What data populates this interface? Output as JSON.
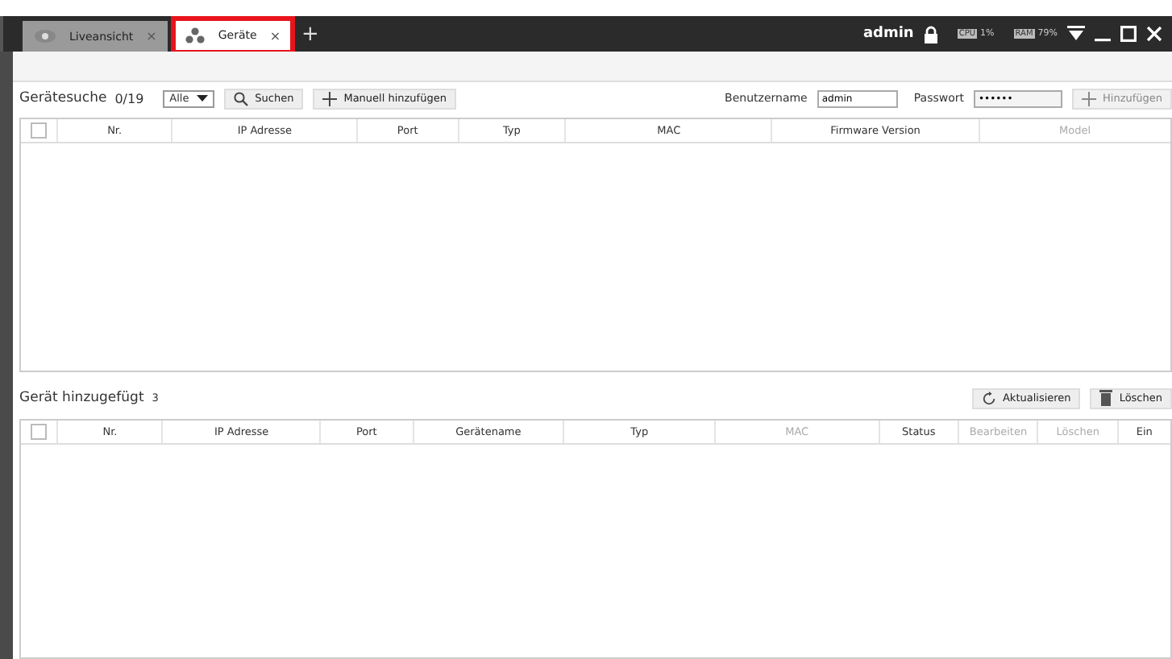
{
  "tabs": [
    {
      "label": "Liveansicht",
      "kind": "live",
      "selected": false,
      "highlighted": false,
      "close": "×"
    },
    {
      "label": "Geräte",
      "kind": "devices",
      "selected": true,
      "highlighted": true,
      "close": "×"
    }
  ],
  "new_tab": "+",
  "status": {
    "user": "admin",
    "cpu_label": "CPU",
    "cpu": "1%",
    "ram_label": "RAM",
    "ram": "79%"
  },
  "search": {
    "title": "Gerätesuche",
    "count": "0/19",
    "filter": "Alle",
    "search_button": "Suchen",
    "manual_button": "Manuell hinzufügen",
    "username_label": "Benutzername",
    "username": "admin",
    "password_label": "Passwort",
    "password": "••••••",
    "add_button": "Hinzufügen",
    "select_all_checked": false,
    "columns": [
      {
        "label": "Nr.",
        "dimmed": false
      },
      {
        "label": "IP Adresse",
        "dimmed": false
      },
      {
        "label": "Port",
        "dimmed": false
      },
      {
        "label": "Typ",
        "dimmed": false
      },
      {
        "label": "MAC",
        "dimmed": false
      },
      {
        "label": "Firmware Version",
        "dimmed": false
      },
      {
        "label": "Model",
        "dimmed": true
      }
    ]
  },
  "added": {
    "title": "Gerät hinzugefügt",
    "count": "3",
    "refresh_button": "Aktualisieren",
    "delete_button": "Löschen",
    "select_all_checked": false,
    "columns": [
      {
        "label": "Nr.",
        "dimmed": false
      },
      {
        "label": "IP Adresse",
        "dimmed": false
      },
      {
        "label": "Port",
        "dimmed": false
      },
      {
        "label": "Gerätename",
        "dimmed": false
      },
      {
        "label": "Typ",
        "dimmed": false
      },
      {
        "label": "MAC",
        "dimmed": true
      },
      {
        "label": "Status",
        "dimmed": false
      },
      {
        "label": "Bearbeiten",
        "dimmed": true
      },
      {
        "label": "Löschen",
        "dimmed": true
      },
      {
        "label": "Ein",
        "dimmed": false
      }
    ]
  }
}
